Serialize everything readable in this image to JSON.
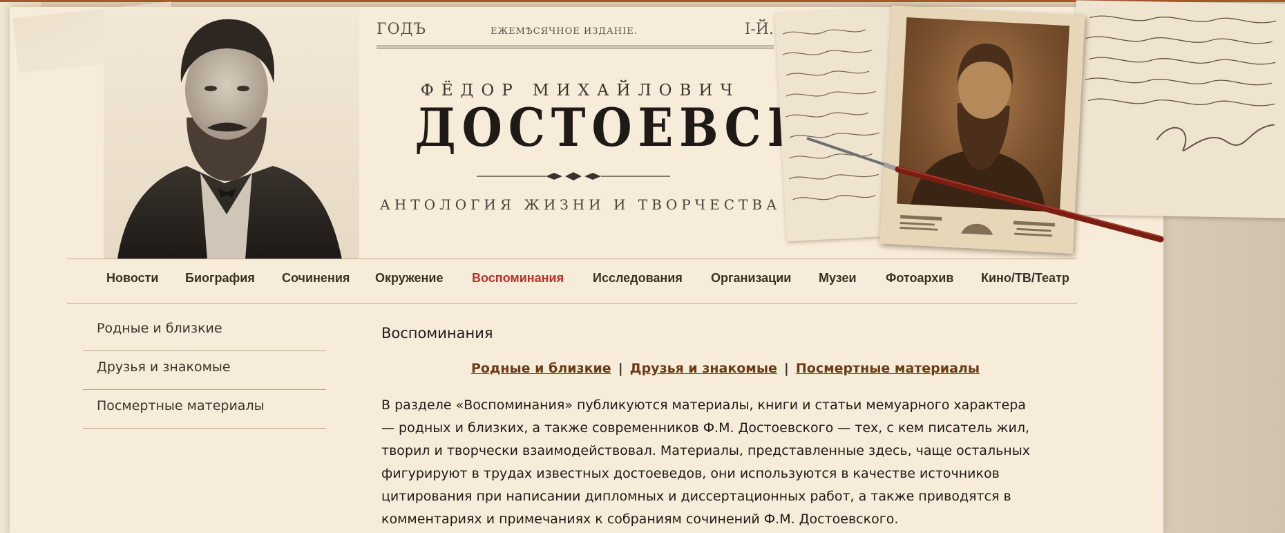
{
  "masthead": {
    "year": "ГОДЪ",
    "edition": "ЕЖЕМѢСЯЧНОЕ ИЗДАНІЕ.",
    "issue": "I-Й.",
    "author_first": "ФЁДОР МИХАЙЛОВИЧ",
    "author_last": "ДОСТОЕВСКИЙ",
    "tagline": "АНТОЛОГИЯ ЖИЗНИ И ТВОРЧЕСТВА"
  },
  "nav": {
    "items": [
      {
        "label": "Новости",
        "active": false
      },
      {
        "label": "Биография",
        "active": false
      },
      {
        "label": "Сочинения",
        "active": false
      },
      {
        "label": "Окружение",
        "active": false
      },
      {
        "label": "Воспоминания",
        "active": true
      },
      {
        "label": "Исследования",
        "active": false
      },
      {
        "label": "Организации",
        "active": false
      },
      {
        "label": "Музеи",
        "active": false
      },
      {
        "label": "Фотоархив",
        "active": false
      },
      {
        "label": "Кино/ТВ/Театр",
        "active": false
      }
    ]
  },
  "sidebar": {
    "items": [
      {
        "label": "Родные и близкие"
      },
      {
        "label": "Друзья и знакомые"
      },
      {
        "label": "Посмертные материалы"
      }
    ]
  },
  "content": {
    "title": "Воспоминания",
    "sublinks": [
      "Родные и близкие",
      "Друзья и знакомые",
      "Посмертные материалы"
    ],
    "separator": "|",
    "body_lines": [
      "В разделе «Воспоминания» публикуются материалы, книги и статьи мемуарного характера",
      "— родных и близких, а также современников Ф.М. Достоевского — тех, с кем писатель жил,",
      "творил и творчески взаимодействовал. Материалы, представленные здесь, чаще остальных",
      "фигурируют в трудах известных достоеведов, они используются в качестве источников",
      "цитирования при написании дипломных и диссертационных работ, а также приводятся в",
      "комментариях и примечаниях к собраниям сочинений Ф.М. Достоевского."
    ]
  },
  "colors": {
    "accent_active": "#b8332b",
    "link": "#6b3a16",
    "paper": "#f7ecd9",
    "top_rule": "#a8572e"
  }
}
